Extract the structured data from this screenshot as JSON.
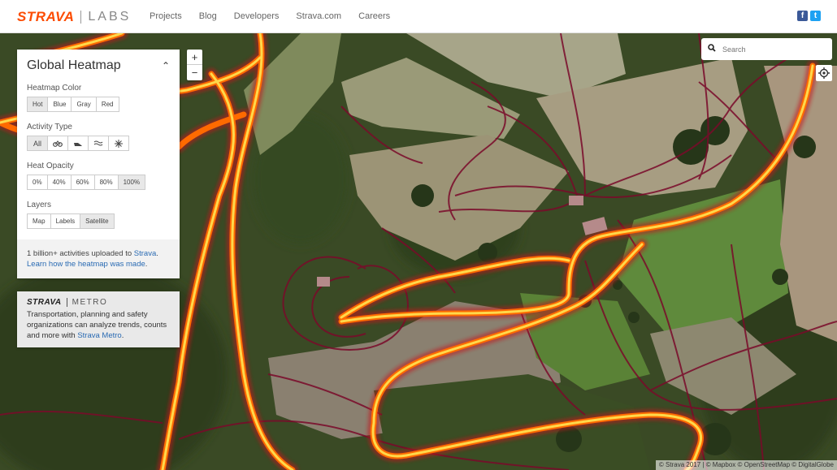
{
  "header": {
    "logo_brand": "STRAVA",
    "logo_sub": "LABS",
    "nav": [
      "Projects",
      "Blog",
      "Developers",
      "Strava.com",
      "Careers"
    ],
    "social": {
      "facebook": "f",
      "twitter": "t"
    }
  },
  "panel": {
    "title": "Global Heatmap",
    "collapse_icon": "chevron-up-icon",
    "heatmap_color": {
      "label": "Heatmap Color",
      "options": [
        "Hot",
        "Blue",
        "Gray",
        "Red"
      ],
      "selected": "Hot"
    },
    "activity_type": {
      "label": "Activity Type",
      "options": [
        "All",
        "bike-icon",
        "run-icon",
        "water-icon",
        "winter-icon"
      ],
      "selected": "All"
    },
    "heat_opacity": {
      "label": "Heat Opacity",
      "options": [
        "0%",
        "40%",
        "60%",
        "80%",
        "100%"
      ],
      "selected": "100%"
    },
    "layers": {
      "label": "Layers",
      "options": [
        "Map",
        "Labels",
        "Satellite"
      ],
      "selected": "Satellite"
    },
    "footer": {
      "text1": "1 billion+ activities uploaded to ",
      "link1": "Strava",
      "text1_end": ".",
      "link2": "Learn how the heatmap was made",
      "text2_end": "."
    }
  },
  "metro": {
    "brand": "STRAVA",
    "sub": "METRO",
    "text": "Transportation, planning and safety organizations can analyze trends, counts and more with ",
    "link": "Strava Metro",
    "text_end": "."
  },
  "zoom": {
    "in": "+",
    "out": "−"
  },
  "search": {
    "placeholder": "Search"
  },
  "attribution": "© Strava 2017 | © Mapbox © OpenStreetMap © DigitalGlobe",
  "colors": {
    "brand": "#fc4c02",
    "heat_hot": "#ffd200",
    "heat_mid": "#ff6a00",
    "heat_low": "#7a0a2a"
  }
}
